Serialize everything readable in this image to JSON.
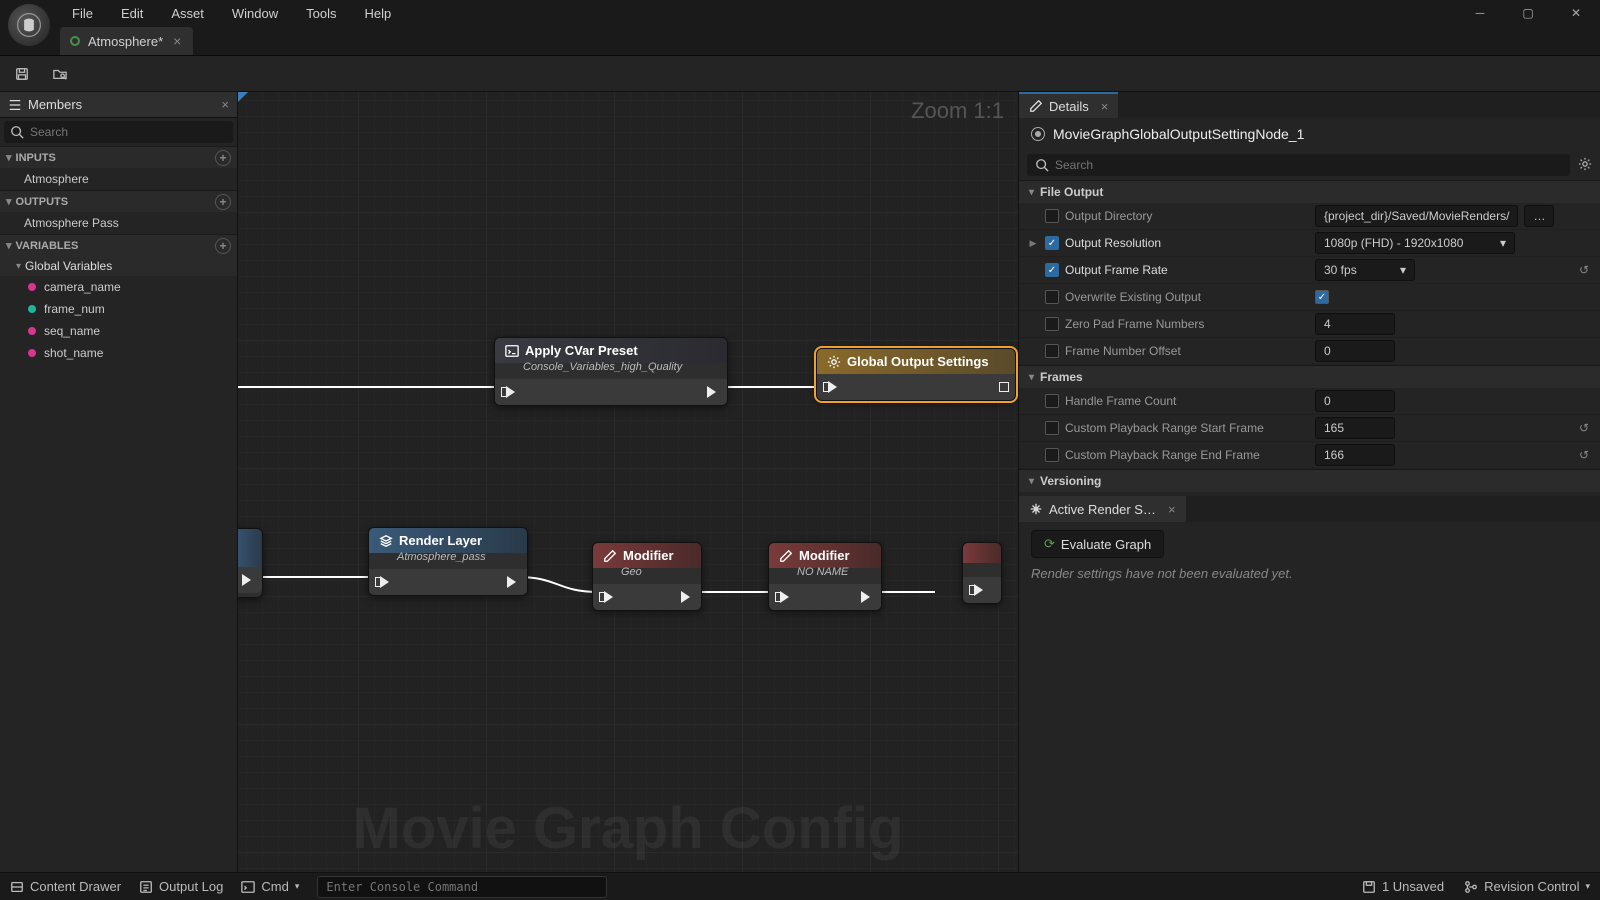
{
  "menu": {
    "items": [
      "File",
      "Edit",
      "Asset",
      "Window",
      "Tools",
      "Help"
    ]
  },
  "tab": {
    "title": "Atmosphere*"
  },
  "members": {
    "title": "Members",
    "search_ph": "Search",
    "inputs_label": "INPUTS",
    "inputs": [
      "Atmosphere"
    ],
    "outputs_label": "OUTPUTS",
    "outputs": [
      "Atmosphere Pass"
    ],
    "variables_label": "VARIABLES",
    "globals_label": "Global Variables",
    "globals": [
      {
        "name": "camera_name",
        "color": "magenta"
      },
      {
        "name": "frame_num",
        "color": "cyan"
      },
      {
        "name": "seq_name",
        "color": "magenta"
      },
      {
        "name": "shot_name",
        "color": "magenta"
      }
    ]
  },
  "graph": {
    "zoom": "Zoom 1:1",
    "watermark": "Movie Graph Config",
    "nodes": {
      "cvar": {
        "title": "Apply CVar Preset",
        "sub": "Console_Variables_high_Quality"
      },
      "gos": {
        "title": "Global Output Settings"
      },
      "rl": {
        "title": "Render Layer",
        "sub": "Atmosphere_pass"
      },
      "mod1": {
        "title": "Modifier",
        "sub": "Geo"
      },
      "mod2": {
        "title": "Modifier",
        "sub": "NO NAME"
      }
    }
  },
  "details": {
    "tab": "Details",
    "object": "MovieGraphGlobalOutputSettingNode_1",
    "search_ph": "Search",
    "cats": {
      "file_output": "File Output",
      "frames": "Frames",
      "versioning": "Versioning"
    },
    "props": {
      "out_dir": {
        "label": "Output Directory",
        "val": "{project_dir}/Saved/MovieRenders/"
      },
      "out_res": {
        "label": "Output Resolution",
        "val": "1080p (FHD) - 1920x1080"
      },
      "out_fps": {
        "label": "Output Frame Rate",
        "val": "30 fps"
      },
      "overwrite": {
        "label": "Overwrite Existing Output"
      },
      "zeropad": {
        "label": "Zero Pad Frame Numbers",
        "val": "4"
      },
      "frameoff": {
        "label": "Frame Number Offset",
        "val": "0"
      },
      "handle": {
        "label": "Handle Frame Count",
        "val": "0"
      },
      "pstart": {
        "label": "Custom Playback Range Start Frame",
        "val": "165"
      },
      "pend": {
        "label": "Custom Playback Range End Frame",
        "val": "166"
      }
    },
    "render_tab": "Active Render S…",
    "eval_btn": "Evaluate Graph",
    "eval_msg": "Render settings have not been evaluated yet."
  },
  "status": {
    "drawer": "Content Drawer",
    "log": "Output Log",
    "cmd": "Cmd",
    "cmd_ph": "Enter Console Command",
    "unsaved": "1 Unsaved",
    "revision": "Revision Control"
  }
}
